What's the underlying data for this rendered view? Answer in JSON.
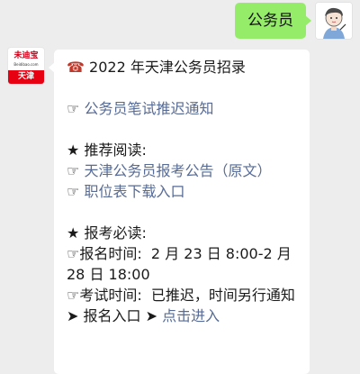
{
  "self_message": {
    "text": "公务员"
  },
  "bot": {
    "brand_name": "未迪宝",
    "brand_url": "Beidibao.com",
    "brand_city": "天津"
  },
  "bot_message": {
    "title_icon": "☎",
    "title": "2022 年天津公务员招录",
    "finger": "☞",
    "notice_link": "公务员笔试推迟通知",
    "star": "★",
    "recommend_heading": "推荐阅读:",
    "recommend_links": [
      "天津公务员报考公告（原文）",
      "职位表下载入口"
    ],
    "must_read_heading": "报考必读:",
    "reg_time_label": "报名时间:",
    "reg_time_value": "2 月 23 日 8:00-2 月 28 日 18:00",
    "exam_time_label": "考试时间:",
    "exam_time_value": "已推迟，时间另行通知",
    "arrow": "➤",
    "entry_label": "报名入口",
    "entry_link": "点击进入"
  }
}
